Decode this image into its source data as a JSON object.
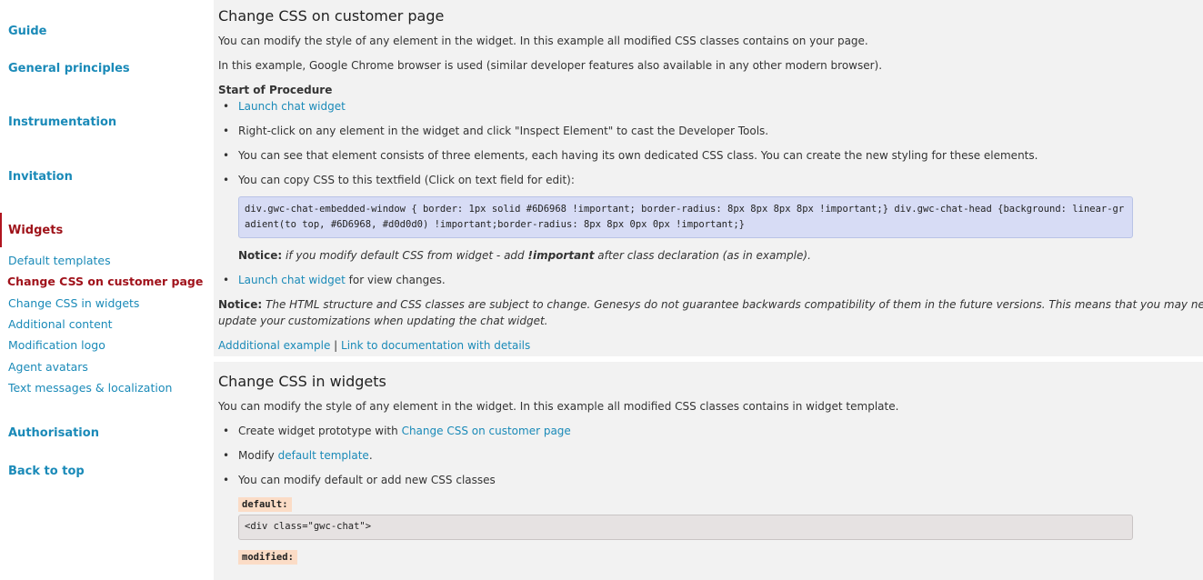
{
  "sidebar": {
    "major": [
      {
        "label": "Guide"
      },
      {
        "label": "General principles"
      },
      {
        "label": "Instrumentation"
      },
      {
        "label": "Invitation"
      },
      {
        "label": "Widgets"
      },
      {
        "label": "Authorisation"
      },
      {
        "label": "Back to top"
      }
    ],
    "minor": [
      {
        "label": "Default templates"
      },
      {
        "label": "Change CSS on customer page"
      },
      {
        "label": "Change CSS in widgets"
      },
      {
        "label": "Additional content"
      },
      {
        "label": "Modification logo"
      },
      {
        "label": "Agent avatars"
      },
      {
        "label": "Text messages & localization"
      }
    ]
  },
  "section1": {
    "title": "Change CSS on customer page",
    "p1": "You can modify the style of any element in the widget. In this example all modified CSS classes contains on your page.",
    "p2": "In this example, Google Chrome browser is used (similar developer features also available in any other modern browser).",
    "procedure": "Start of Procedure",
    "b1_link": "Launch chat widget",
    "b2": "Right-click on any element in the widget and click \"Inspect Element\" to cast the Developer Tools.",
    "b3": "You can see that element consists of three elements, each having its own dedicated CSS class. You can create the new styling for these elements.",
    "b4": "You can copy CSS to this textfield (Click on text field for edit):",
    "code": "div.gwc-chat-embedded-window { border: 1px solid #6D6968 !important; border-radius: 8px 8px 8px 8px !important;} div.gwc-chat-head {background: linear-gradient(to top, #6D6968, #d0d0d0) !important;border-radius: 8px 8px 0px 0px !important;}",
    "notice1_label": "Notice:",
    "notice1_a": "if you modify default CSS from widget - add",
    "notice1_b": "!important",
    "notice1_c": "after class declaration (as in example).",
    "b5_link": "Launch chat widget",
    "b5_text": "for view changes.",
    "notice2_label": "Notice:",
    "notice2_line1": "The HTML structure and CSS classes are subject to change. Genesys do not guarantee backwards compatibility of them in the future versions. This means that you may need to",
    "notice2_line2": "update your customizations when updating the chat widget.",
    "link_example": "Addditional example",
    "sep": "|",
    "link_docs": "Link to documentation with details"
  },
  "section2": {
    "title": "Change CSS in widgets",
    "p1": "You can modify the style of any element in the widget. In this example all modified CSS classes contains in widget template.",
    "b1_text": "Create widget prototype with",
    "b1_link": "Change CSS on customer page",
    "b2_text": "Modify",
    "b2_link": "default template",
    "b2_end": ".",
    "b3": "You can modify default or add new CSS classes",
    "tag_default": "default:",
    "code_default": "<div class=\"gwc-chat\">",
    "tag_modified": "modified:"
  }
}
